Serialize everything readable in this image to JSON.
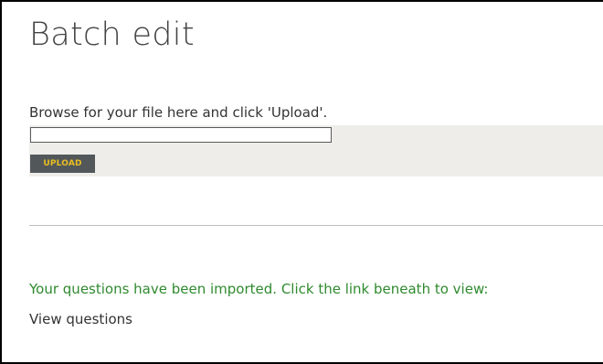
{
  "page": {
    "title": "Batch edit"
  },
  "upload": {
    "instructions": "Browse for your file here and click 'Upload'.",
    "file_value": "",
    "button_label": "UPLOAD"
  },
  "result": {
    "message": "Your questions have been imported. Click the link beneath to view:",
    "link_label": "View questions"
  },
  "colors": {
    "success_text": "#2f8a2f",
    "button_bg": "#52585a",
    "button_text": "#e9bd22",
    "panel_bg": "#eeedea"
  }
}
